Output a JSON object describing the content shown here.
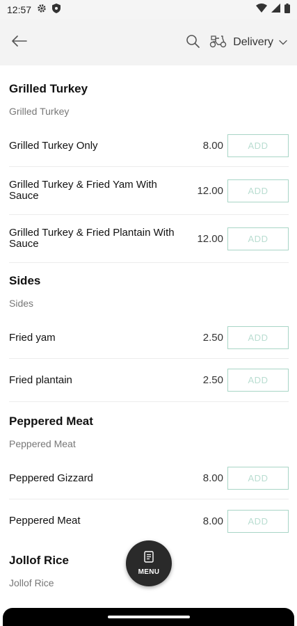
{
  "status_bar": {
    "time": "12:57",
    "icons": [
      "gear-icon",
      "shield-icon",
      "wifi-icon",
      "signal-icon",
      "battery-icon"
    ]
  },
  "header": {
    "back_icon": "arrow-left-icon",
    "search_icon": "search-icon",
    "delivery_icon": "scooter-icon",
    "delivery_label": "Delivery",
    "dropdown_icon": "chevron-down-icon"
  },
  "menu": {
    "sections": [
      {
        "title": "Grilled Turkey",
        "subtitle": "Grilled Turkey",
        "items": [
          {
            "name": "Grilled Turkey Only",
            "price": "8.00",
            "button": "ADD"
          },
          {
            "name": "Grilled Turkey & Fried Yam With Sauce",
            "price": "12.00",
            "button": "ADD"
          },
          {
            "name": "Grilled Turkey & Fried Plantain With Sauce",
            "price": "12.00",
            "button": "ADD"
          }
        ]
      },
      {
        "title": "Sides",
        "subtitle": "Sides",
        "items": [
          {
            "name": "Fried yam",
            "price": "2.50",
            "button": "ADD"
          },
          {
            "name": "Fried plantain",
            "price": "2.50",
            "button": "ADD"
          }
        ]
      },
      {
        "title": "Peppered Meat",
        "subtitle": "Peppered Meat",
        "items": [
          {
            "name": "Peppered Gizzard",
            "price": "8.00",
            "button": "ADD"
          },
          {
            "name": "Peppered Meat",
            "price": "8.00",
            "button": "ADD"
          }
        ]
      },
      {
        "title": "Jollof Rice",
        "subtitle": "Jollof Rice",
        "items": []
      }
    ]
  },
  "fab": {
    "icon": "menu-document-icon",
    "label": "MENU"
  },
  "colors": {
    "accent_border": "#a8d5c6",
    "accent_text": "#b9ddd1",
    "fab_bg": "#2a2a2a"
  }
}
